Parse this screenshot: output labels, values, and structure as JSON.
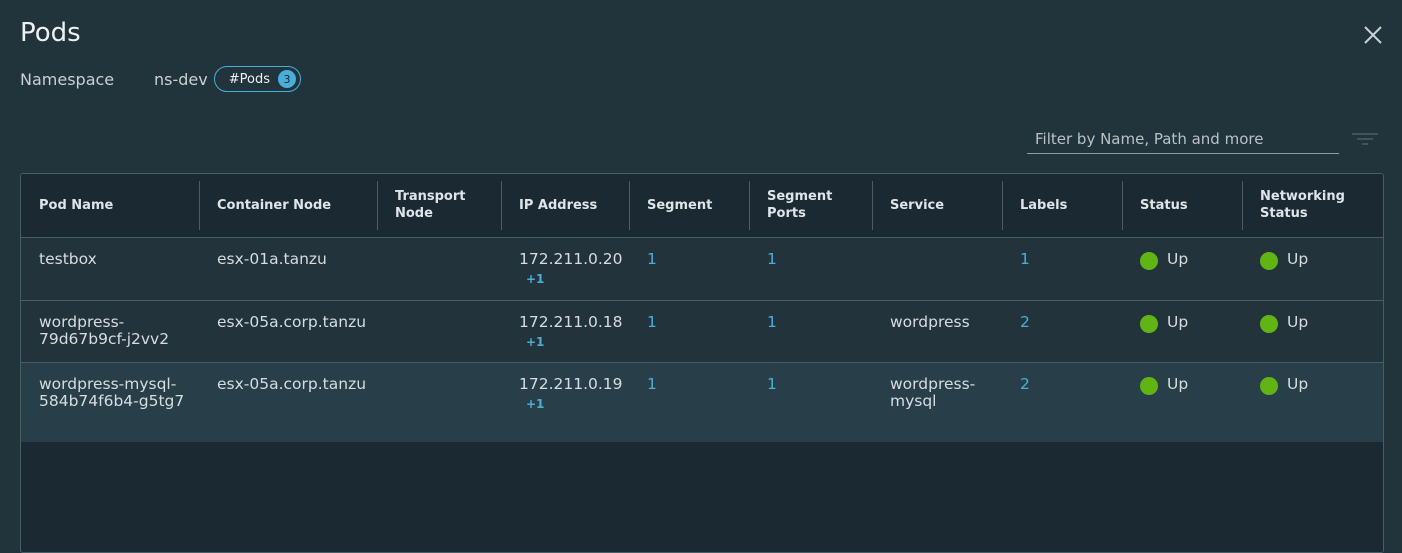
{
  "page": {
    "title": "Pods",
    "namespace_label": "Namespace",
    "namespace_value": "ns-dev",
    "pods_badge_label": "#Pods",
    "pods_badge_count": "3"
  },
  "filter": {
    "placeholder": "Filter by Name, Path and more",
    "value": ""
  },
  "table": {
    "columns": [
      "Pod Name",
      "Container Node",
      "Transport Node",
      "IP Address",
      "Segment",
      "Segment Ports",
      "Service",
      "Labels",
      "Status",
      "Networking Status"
    ],
    "rows": [
      {
        "pod_name": "testbox",
        "container_node": "esx-01a.tanzu",
        "transport_node": "",
        "ip_address": "172.211.0.20",
        "ip_extra": "+1",
        "segment": "1",
        "segment_ports": "1",
        "service": "",
        "labels": "1",
        "status": "Up",
        "networking_status": "Up"
      },
      {
        "pod_name": "wordpress-79d67b9cf-j2vv2",
        "container_node": "esx-05a.corp.tanzu",
        "transport_node": "",
        "ip_address": "172.211.0.18",
        "ip_extra": "+1",
        "segment": "1",
        "segment_ports": "1",
        "service": "wordpress",
        "labels": "2",
        "status": "Up",
        "networking_status": "Up"
      },
      {
        "pod_name": "wordpress-mysql-584b74f6b4-g5tg7",
        "container_node": "esx-05a.corp.tanzu",
        "transport_node": "",
        "ip_address": "172.211.0.19",
        "ip_extra": "+1",
        "segment": "1",
        "segment_ports": "1",
        "service": "wordpress-mysql",
        "labels": "2",
        "status": "Up",
        "networking_status": "Up"
      }
    ]
  },
  "colors": {
    "background": "#21333b",
    "link": "#49afd9",
    "status_up": "#60b515"
  },
  "icons": {
    "close": "close-icon",
    "filter": "filter-icon",
    "status": "status-up-icon"
  }
}
